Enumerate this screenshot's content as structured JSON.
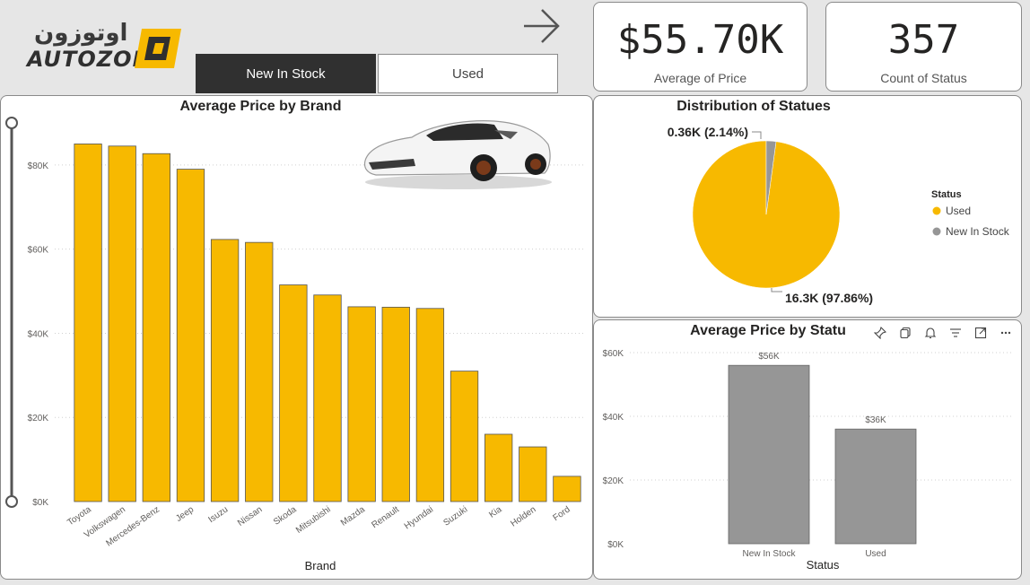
{
  "brand": {
    "arabic": "اوتوزون",
    "latin": "AUTOZONE"
  },
  "tabs": [
    {
      "label": "New In Stock",
      "active": true
    },
    {
      "label": "Used",
      "active": false
    }
  ],
  "kpis": [
    {
      "value": "$55.70K",
      "label": "Average of Price"
    },
    {
      "value": "357",
      "label": "Count of Status"
    }
  ],
  "colors": {
    "accent": "#F7B900",
    "gray": "#969696",
    "dark": "#303030"
  },
  "icons": [
    "arrow-right-icon",
    "car-image",
    "pin-icon",
    "copy-icon",
    "bell-icon",
    "filter-icon",
    "focus-mode-icon",
    "more-options-icon"
  ],
  "chart_data": [
    {
      "type": "bar",
      "title": "Average Price by Brand",
      "xlabel": "Brand",
      "ylabel": "",
      "categories": [
        "Toyota",
        "Volkswagen",
        "Mercedes-Benz",
        "Jeep",
        "Isuzu",
        "Nissan",
        "Skoda",
        "Mitsubishi",
        "Mazda",
        "Renault",
        "Hyundai",
        "Suzuki",
        "Kia",
        "Holden",
        "Ford"
      ],
      "values": [
        85000,
        84500,
        82700,
        79000,
        62300,
        61600,
        51500,
        49100,
        46300,
        46200,
        45900,
        31000,
        16000,
        13000,
        6000
      ],
      "ylim": [
        0,
        90000
      ],
      "yticks": [
        0,
        20000,
        40000,
        60000,
        80000
      ],
      "ytick_labels": [
        "$0K",
        "$20K",
        "$40K",
        "$60K",
        "$80K"
      ],
      "grid": true
    },
    {
      "type": "pie",
      "title": "Distribution of Statues",
      "legend_title": "Status",
      "legend_position": "right",
      "slices": [
        {
          "name": "Used",
          "value": 97.86,
          "label": "16.3K (97.86%)"
        },
        {
          "name": "New In Stock",
          "value": 2.14,
          "label": "0.36K (2.14%)"
        }
      ]
    },
    {
      "type": "bar",
      "title": "Average Price by Statu",
      "xlabel": "Status",
      "ylabel": "",
      "categories": [
        "New In Stock",
        "Used"
      ],
      "values": [
        56000,
        36000
      ],
      "data_labels": [
        "$56K",
        "$36K"
      ],
      "ylim": [
        0,
        60000
      ],
      "yticks": [
        0,
        20000,
        40000,
        60000
      ],
      "ytick_labels": [
        "$0K",
        "$20K",
        "$40K",
        "$60K"
      ],
      "grid": true
    }
  ]
}
